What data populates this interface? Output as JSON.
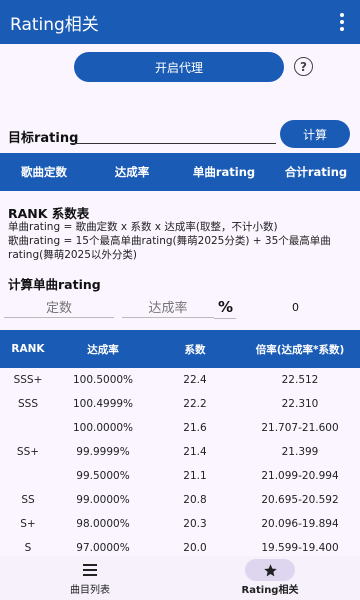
{
  "app": {
    "title": "Rating相关"
  },
  "proxy_button": "开启代理",
  "help_symbol": "?",
  "target": {
    "label": "目标rating",
    "value": "",
    "calc_button": "计算"
  },
  "header_bar": [
    "歌曲定数",
    "达成率",
    "单曲rating",
    "合计rating"
  ],
  "rank_section": {
    "title": "RANK 系数表",
    "lines": [
      "单曲rating = 歌曲定数 x 系数 x 达成率(取整，不计小数)",
      "歌曲rating = 15个最高单曲rating(舞萌2025分类) + 35个最高单曲",
      "rating(舞萌2025以外分类)"
    ]
  },
  "single_calc": {
    "title": "计算单曲rating",
    "const_placeholder": "定数",
    "acc_placeholder": "达成率",
    "percent_symbol": "%",
    "result": "0"
  },
  "table": {
    "headers": [
      "RANK",
      "达成率",
      "系数",
      "倍率(达成率*系数)"
    ],
    "rows": [
      [
        "SSS+",
        "100.5000%",
        "22.4",
        "22.512"
      ],
      [
        "SSS",
        "100.4999%",
        "22.2",
        "22.310"
      ],
      [
        "",
        "100.0000%",
        "21.6",
        "21.707-21.600"
      ],
      [
        "SS+",
        "99.9999%",
        "21.4",
        "21.399"
      ],
      [
        "",
        "99.5000%",
        "21.1",
        "21.099-20.994"
      ],
      [
        "SS",
        "99.0000%",
        "20.8",
        "20.695-20.592"
      ],
      [
        "S+",
        "98.0000%",
        "20.3",
        "20.096-19.894"
      ],
      [
        "S",
        "97.0000%",
        "20.0",
        "19.599-19.400"
      ]
    ]
  },
  "bottom_nav": [
    {
      "label": "曲目列表",
      "icon": "list-icon",
      "active": false
    },
    {
      "label": "Rating相关",
      "icon": "star-icon",
      "active": true
    }
  ]
}
